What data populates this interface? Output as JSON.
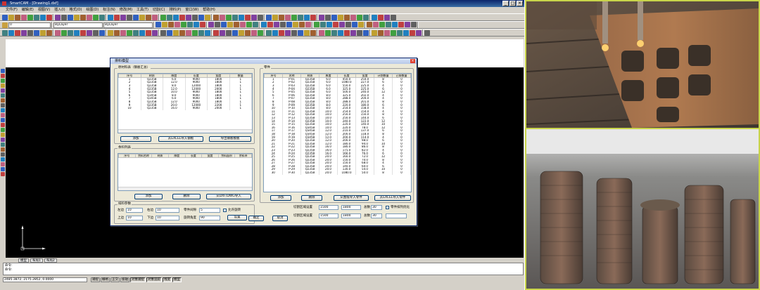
{
  "window": {
    "title": "SmartCAM - [Drawing1.dxf]"
  },
  "menu": [
    "文件(F)",
    "编辑(E)",
    "视图(V)",
    "插入(I)",
    "格式(O)",
    "绘图(D)",
    "标注(N)",
    "修改(M)",
    "工具(T)",
    "切割(C)",
    "排料(P)",
    "窗口(W)",
    "帮助(H)"
  ],
  "toolbar": {
    "layer_select": "0",
    "color_select": "ByLayer",
    "line_select": "ByLayer"
  },
  "dialog": {
    "title": "排料模型",
    "plates_group": "原材料表（钢板汇总）",
    "plates_headers": [
      "序号",
      "材质",
      "厚度",
      "长度",
      "宽度",
      "数量"
    ],
    "plates_rows": [
      [
        "1",
        "Q235B",
        "6.0",
        "9000",
        "1800",
        "1"
      ],
      [
        "2",
        "Q235B",
        "12.0",
        "9000",
        "1800",
        "1"
      ],
      [
        "3",
        "Q235B",
        "8.0",
        "12000",
        "1800",
        "1"
      ],
      [
        "4",
        "Q235B",
        "12.0",
        "12000",
        "2000",
        "1"
      ],
      [
        "5",
        "Q235B",
        "10.0",
        "9000",
        "1800",
        "1"
      ],
      [
        "6",
        "Q345B",
        "8.0",
        "9000",
        "1800",
        "1"
      ],
      [
        "7",
        "Q345B",
        "6.0",
        "9000",
        "1800",
        "1"
      ],
      [
        "8",
        "Q235B",
        "12.0",
        "9000",
        "1800",
        "1"
      ],
      [
        "9",
        "Q235B",
        "20.0",
        "12000",
        "2200",
        "1"
      ],
      [
        "10",
        "Q235B",
        "16.0",
        "9000",
        "2000",
        "1"
      ]
    ],
    "plates_buttons": [
      "添加",
      "从EXCEL导入钢板",
      "导出钢板模板"
    ],
    "remnant_group": "余料列表",
    "remnant_headers": [
      "序号",
      "余料名称",
      "材质",
      "厚度",
      "长度",
      "宽度",
      "余料面积",
      "余料率"
    ],
    "remnant_buttons": [
      "添加",
      "删除",
      "从DXF/DWG导入"
    ],
    "params_group": "排料参数",
    "params": {
      "left_margin_label": "左边",
      "left_margin": "10",
      "right_margin_label": "右边",
      "right_margin": "10",
      "spacing_label": "间距",
      "spacing": "10",
      "gap_label": "零件间隙",
      "gap": "5",
      "top_margin_label": "上边",
      "top_margin": "10",
      "bottom_margin_label": "下边",
      "bottom_margin": "10",
      "rotate_label": "旋转角度",
      "rotate": "90",
      "auto_rotate_label": "允许旋转",
      "settings_btn": "设置"
    },
    "parts_group": "零件",
    "parts_headers": [
      "序号",
      "名称",
      "材质",
      "厚度",
      "长度",
      "宽度",
      "计划数量",
      "已排数量"
    ],
    "parts_rows": [
      [
        "1",
        "P-01",
        "Q235B",
        "6.0",
        "450.0",
        "254.0",
        "8",
        "0"
      ],
      [
        "2",
        "P-02",
        "Q235B",
        "6.0",
        "1080.0",
        "227.0",
        "6",
        "0"
      ],
      [
        "3",
        "P-03",
        "Q235B",
        "6.0",
        "550.0",
        "225.0",
        "4",
        "0"
      ],
      [
        "4",
        "P-04",
        "Q235B",
        "6.0",
        "325.0",
        "225.0",
        "6",
        "0"
      ],
      [
        "5",
        "P-05",
        "Q235B",
        "6.0",
        "500.0",
        "240.0",
        "12",
        "0"
      ],
      [
        "6",
        "P-06",
        "Q235B",
        "8.0",
        "325.0",
        "202.0",
        "4",
        "0"
      ],
      [
        "7",
        "P-07",
        "Q235B",
        "8.0",
        "288.0",
        "204.0",
        "4",
        "0"
      ],
      [
        "8",
        "P-08",
        "Q235B",
        "8.0",
        "288.0",
        "201.0",
        "8",
        "0"
      ],
      [
        "9",
        "P-09",
        "Q235B",
        "8.0",
        "220.0",
        "180.0",
        "6",
        "0"
      ],
      [
        "10",
        "P-10",
        "Q235B",
        "8.0",
        "254.0",
        "158.0",
        "4",
        "0"
      ],
      [
        "11",
        "P-11",
        "Q235B",
        "10.0",
        "254.0",
        "154.0",
        "4",
        "0"
      ],
      [
        "12",
        "P-12",
        "Q235B",
        "10.0",
        "250.0",
        "150.0",
        "8",
        "0"
      ],
      [
        "13",
        "P-13",
        "Q235B",
        "10.0",
        "250.0",
        "144.0",
        "6",
        "0"
      ],
      [
        "14",
        "P-14",
        "Q235B",
        "10.0",
        "240.0",
        "122.0",
        "12",
        "0"
      ],
      [
        "15",
        "P-15",
        "Q235B",
        "10.0",
        "220.0",
        "140.0",
        "10",
        "0"
      ],
      [
        "16",
        "P-16",
        "Q345B",
        "10.0",
        "220.0",
        "78.0",
        "12",
        "0"
      ],
      [
        "17",
        "P-17",
        "Q345B",
        "12.0",
        "210.0",
        "137.0",
        "6",
        "0"
      ],
      [
        "18",
        "P-18",
        "Q345B",
        "12.0",
        "200.0",
        "118.0",
        "8",
        "0"
      ],
      [
        "19",
        "P-19",
        "Q345B",
        "12.0",
        "200.0",
        "114.0",
        "4",
        "0"
      ],
      [
        "20",
        "P-20",
        "Q235B",
        "12.0",
        "200.0",
        "98.0",
        "6",
        "0"
      ],
      [
        "21",
        "P-21",
        "Q235B",
        "12.0",
        "180.0",
        "94.0",
        "10",
        "0"
      ],
      [
        "22",
        "P-22",
        "Q235B",
        "16.0",
        "180.0",
        "86.0",
        "8",
        "0"
      ],
      [
        "23",
        "P-23",
        "Q235B",
        "16.0",
        "175.0",
        "82.0",
        "4",
        "0"
      ],
      [
        "24",
        "P-24",
        "Q235B",
        "16.0",
        "166.0",
        "76.0",
        "6",
        "0"
      ],
      [
        "25",
        "P-25",
        "Q235B",
        "20.0",
        "160.0",
        "72.0",
        "12",
        "0"
      ],
      [
        "26",
        "P-26",
        "Q235B",
        "20.0",
        "150.0",
        "70.0",
        "8",
        "0"
      ],
      [
        "27",
        "P-27",
        "Q235B",
        "20.0",
        "150.0",
        "68.0",
        "4",
        "0"
      ],
      [
        "28",
        "P-28",
        "Q235B",
        "20.0",
        "140.0",
        "60.0",
        "6",
        "0"
      ],
      [
        "29",
        "P-29",
        "Q235B",
        "20.0",
        "130.0",
        "54.0",
        "10",
        "0"
      ],
      [
        "30",
        "P-30",
        "Q235B",
        "20.0",
        "1080.0",
        "50.0",
        "8",
        "0"
      ]
    ],
    "parts_buttons": [
      "添加",
      "删除",
      "从图纸导入零件",
      "从EXCEL导入零件"
    ],
    "nest_params": {
      "area_label": "切割区域设置",
      "area_x": "1500",
      "area_y": "1800",
      "total_label": "总数",
      "total": "30",
      "area2_label": "切割区域设置",
      "area2_x": "1500",
      "area2_y": "1800",
      "total2_label": "总数",
      "total2": "30",
      "chk1_label": "零件排列优化"
    },
    "bottom_buttons": [
      "确定",
      "取消"
    ]
  },
  "tabs": [
    "模型",
    "布局1",
    "布局2"
  ],
  "command": [
    "命令:",
    "命令:"
  ],
  "status": {
    "coords": "2485.3872, 2175.2852, 0.0000",
    "modes": [
      "捕捉",
      "栅格",
      "正交",
      "极轴",
      "对象捕捉",
      "对象追踪",
      "线宽",
      "模型"
    ]
  },
  "colors": {
    "titlebar": "#0a246a",
    "canvas": "#000000",
    "dialog_bg": "#ece9d8",
    "photo_border": "#c8d44a"
  }
}
